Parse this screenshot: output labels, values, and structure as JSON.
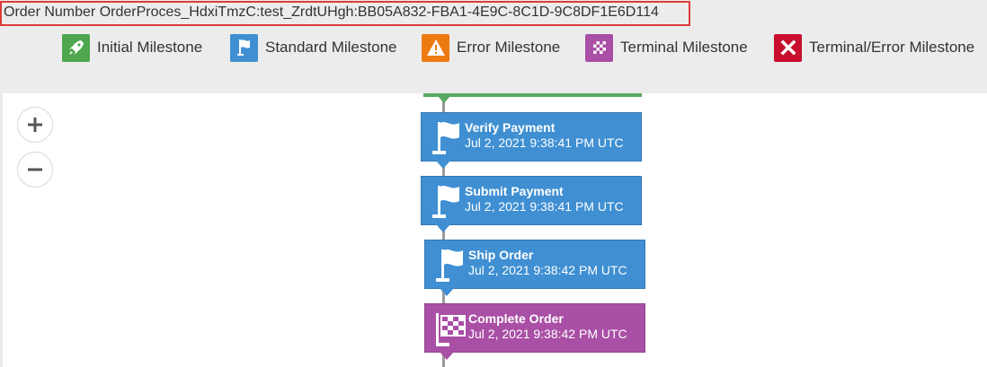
{
  "header": {
    "order_title": "Order Number OrderProces_HdxiTmzC:test_ZrdtUHgh:BB05A832-FBA1-4E9C-8C1D-9C8DF1E6D114"
  },
  "legend": [
    {
      "label": "Initial Milestone",
      "icon": "rocket-icon",
      "color": "#4ea64f"
    },
    {
      "label": "Standard Milestone",
      "icon": "flag-icon",
      "color": "#3f8fd2"
    },
    {
      "label": "Error Milestone",
      "icon": "warning-icon",
      "color": "#ee7a12"
    },
    {
      "label": "Terminal Milestone",
      "icon": "checkered-flag-icon",
      "color": "#a94fa5"
    },
    {
      "label": "Terminal/Error Milestone",
      "icon": "close-icon",
      "color": "#c8102e"
    }
  ],
  "milestones": [
    {
      "name": "Verify Payment",
      "time": "Jul 2, 2021 9:38:41 PM UTC",
      "kind": "standard"
    },
    {
      "name": "Submit Payment",
      "time": "Jul 2, 2021 9:38:41 PM UTC",
      "kind": "standard"
    },
    {
      "name": "Ship Order",
      "time": "Jul 2, 2021 9:38:42 PM UTC",
      "kind": "standard"
    },
    {
      "name": "Complete Order",
      "time": "Jul 2, 2021 9:38:42 PM UTC",
      "kind": "terminal"
    }
  ],
  "zoom": {
    "in_symbol": "+",
    "out_symbol": "−"
  }
}
